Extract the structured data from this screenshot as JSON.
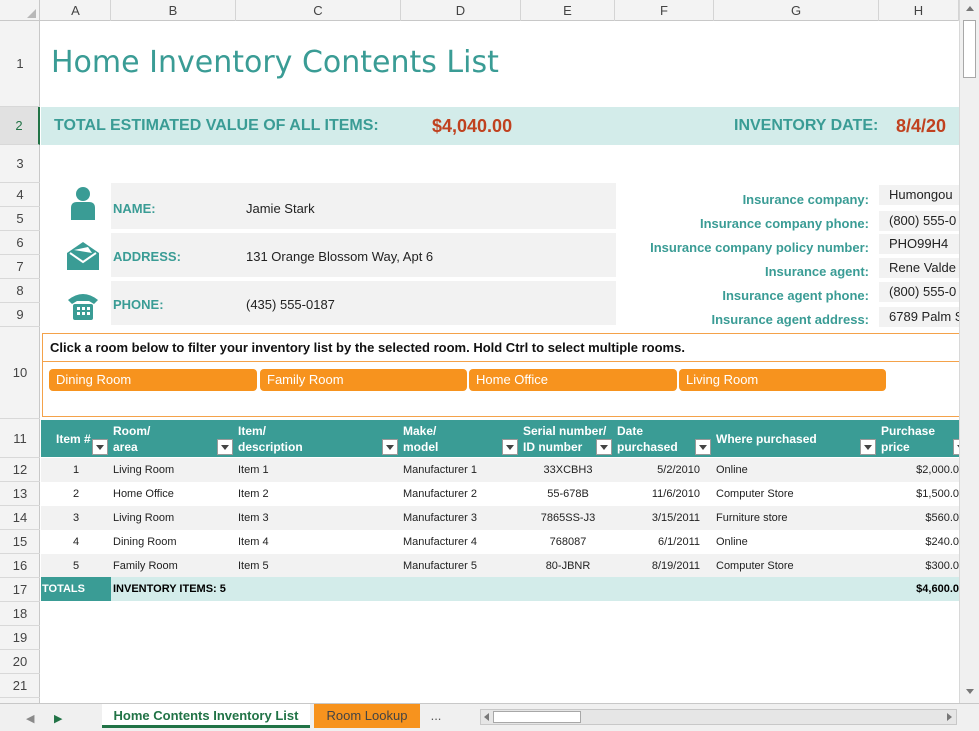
{
  "columns": [
    "A",
    "B",
    "C",
    "D",
    "E",
    "F",
    "G",
    "H"
  ],
  "rows": [
    "1",
    "2",
    "3",
    "4",
    "5",
    "6",
    "7",
    "8",
    "9",
    "10",
    "11",
    "12",
    "13",
    "14",
    "15",
    "16",
    "17",
    "18",
    "19",
    "20",
    "21"
  ],
  "title": "Home Inventory Contents List",
  "summary": {
    "total_label": "TOTAL ESTIMATED VALUE OF ALL ITEMS:",
    "total_value": "$4,040.00",
    "date_label": "INVENTORY DATE:",
    "date_value": "8/4/20"
  },
  "owner": {
    "name_label": "NAME:",
    "name_value": "Jamie Stark",
    "address_label": "ADDRESS:",
    "address_value": "131 Orange Blossom Way, Apt 6",
    "phone_label": "PHONE:",
    "phone_value": "(435) 555-0187"
  },
  "insurance": [
    {
      "label": "Insurance company:",
      "value": "Humongou"
    },
    {
      "label": "Insurance company phone:",
      "value": "(800) 555-0"
    },
    {
      "label": "Insurance company policy number:",
      "value": "PHO99H4"
    },
    {
      "label": "Insurance agent:",
      "value": "Rene Valde"
    },
    {
      "label": "Insurance agent phone:",
      "value": "(800) 555-0"
    },
    {
      "label": "Insurance agent address:",
      "value": "6789 Palm S"
    }
  ],
  "slicer": {
    "instruction": "Click a room below to filter your inventory list by the selected room. Hold Ctrl to select multiple rooms.",
    "rooms": [
      "Dining Room",
      "Family Room",
      "Home Office",
      "Living Room"
    ]
  },
  "table": {
    "headers": {
      "item_no": "Item #",
      "room_1": "Room/",
      "room_2": "area",
      "item_1": "Item/",
      "item_2": "description",
      "make_1": "Make/",
      "make_2": "model",
      "serial_1": "Serial number/",
      "serial_2": "ID number",
      "date_1": "Date",
      "date_2": "purchased",
      "where": "Where purchased",
      "price_1": "Purchase",
      "price_2": "price"
    },
    "rows": [
      {
        "no": "1",
        "room": "Living Room",
        "item": "Item 1",
        "make": "Manufacturer 1",
        "serial": "33XCBH3",
        "date": "5/2/2010",
        "where": "Online",
        "price": "$2,000.0"
      },
      {
        "no": "2",
        "room": "Home Office",
        "item": "Item 2",
        "make": "Manufacturer 2",
        "serial": "55-678B",
        "date": "11/6/2010",
        "where": "Computer Store",
        "price": "$1,500.0"
      },
      {
        "no": "3",
        "room": "Living Room",
        "item": "Item 3",
        "make": "Manufacturer 3",
        "serial": "7865SS-J3",
        "date": "3/15/2011",
        "where": "Furniture store",
        "price": "$560.0"
      },
      {
        "no": "4",
        "room": "Dining Room",
        "item": "Item 4",
        "make": "Manufacturer 4",
        "serial": "768087",
        "date": "6/1/2011",
        "where": "Online",
        "price": "$240.0"
      },
      {
        "no": "5",
        "room": "Family Room",
        "item": "Item 5",
        "make": "Manufacturer 5",
        "serial": "80-JBNR",
        "date": "8/19/2011",
        "where": "Computer Store",
        "price": "$300.0"
      }
    ],
    "totals": {
      "label": "TOTALS",
      "items": "INVENTORY ITEMS: 5",
      "price": "$4,600.0"
    }
  },
  "sheet_tabs": {
    "active": "Home Contents Inventory List",
    "other": "Room Lookup",
    "more": "..."
  },
  "colors": {
    "teal": "#3a9c95",
    "teal_light": "#d3ecea",
    "accent_red": "#c0411f",
    "orange": "#f7931e"
  }
}
